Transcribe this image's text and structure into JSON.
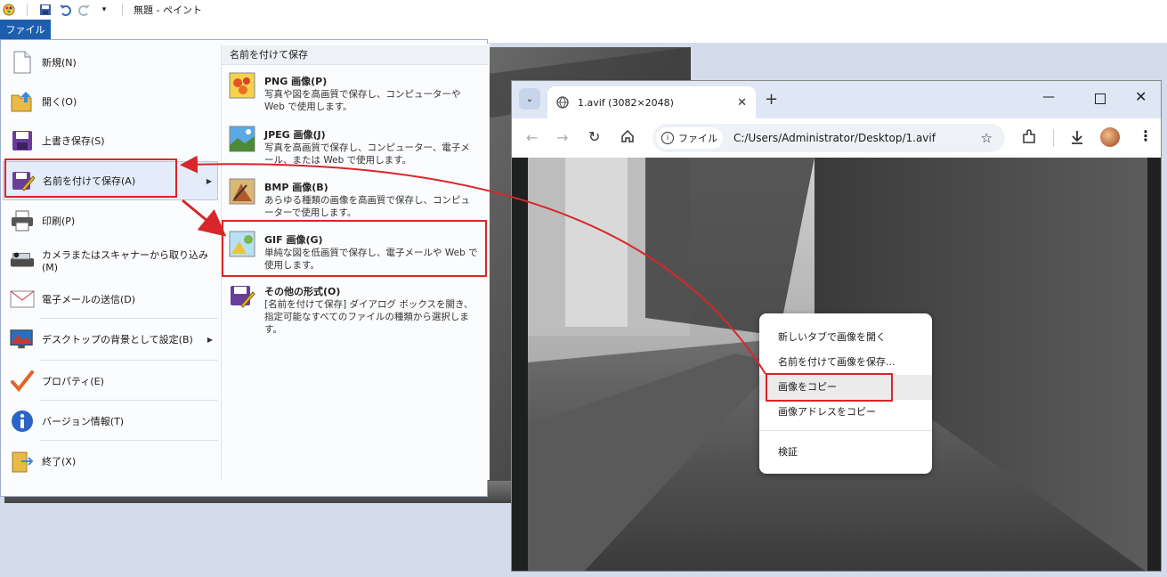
{
  "paint": {
    "window_title": "無題 - ペイント",
    "file_tab": "ファイル",
    "menu": [
      {
        "label": "新規(N)",
        "icon": "new-document-icon"
      },
      {
        "label": "開く(O)",
        "icon": "open-folder-icon"
      },
      {
        "label": "上書き保存(S)",
        "icon": "save-disk-icon"
      },
      {
        "label": "名前を付けて保存(A)",
        "icon": "save-as-icon"
      },
      {
        "label": "印刷(P)",
        "icon": "printer-icon"
      },
      {
        "label": "カメラまたはスキャナーから取り込み(M)",
        "icon": "scanner-icon"
      },
      {
        "label": "電子メールの送信(D)",
        "icon": "email-icon"
      },
      {
        "label": "デスクトップの背景として設定(B)",
        "icon": "desktop-background-icon"
      },
      {
        "label": "プロパティ(E)",
        "icon": "checkmark-icon"
      },
      {
        "label": "バージョン情報(T)",
        "icon": "info-icon"
      },
      {
        "label": "終了(X)",
        "icon": "exit-folder-icon"
      }
    ],
    "submenu": {
      "header": "名前を付けて保存",
      "items": [
        {
          "title": "PNG 画像(P)",
          "desc": "写真や図を高画質で保存し、コンピューターや Web で使用します。"
        },
        {
          "title": "JPEG 画像(J)",
          "desc": "写真を高画質で保存し、コンピューター、電子メール、または Web で使用します。"
        },
        {
          "title": "BMP 画像(B)",
          "desc": "あらゆる種類の画像を高画質で保存し、コンピューターで使用します。"
        },
        {
          "title": "GIF 画像(G)",
          "desc": "単純な図を低画質で保存し、電子メールや Web で使用します。"
        },
        {
          "title": "その他の形式(O)",
          "desc": "[名前を付けて保存] ダイアログ ボックスを開き、指定可能なすべてのファイルの種類から選択します。"
        }
      ]
    }
  },
  "browser": {
    "tab_title": "1.avif (3082×2048)",
    "chip_label": "ファイル",
    "url": "C:/Users/Administrator/Desktop/1.avif",
    "context_menu": [
      "新しいタブで画像を開く",
      "名前を付けて画像を保存...",
      "画像をコピー",
      "画像アドレスをコピー",
      "検証"
    ]
  },
  "colors": {
    "highlight": "#d8262a",
    "file_tab": "#1d5fae",
    "tabbar": "#dfe7f5"
  }
}
